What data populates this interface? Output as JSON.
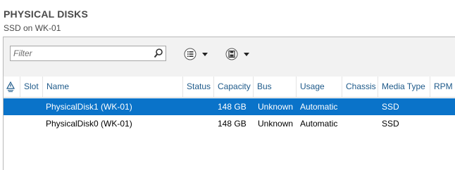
{
  "header": {
    "title": "PHYSICAL DISKS",
    "subtitle": "SSD on WK-01"
  },
  "toolbar": {
    "filter_placeholder": "Filter",
    "search_icon": "search-icon",
    "view_options_icon": "list-view-icon",
    "save_query_icon": "save-icon"
  },
  "table": {
    "columns": [
      "Slot",
      "Name",
      "Status",
      "Capacity",
      "Bus",
      "Usage",
      "Chassis",
      "Media Type",
      "RPM"
    ],
    "rows": [
      {
        "warning": "",
        "slot": "",
        "name": "PhysicalDisk1 (WK-01)",
        "status": "",
        "capacity": "148 GB",
        "bus": "Unknown",
        "usage": "Automatic",
        "chassis": "",
        "media_type": "SSD",
        "rpm": "",
        "selected": true
      },
      {
        "warning": "",
        "slot": "",
        "name": "PhysicalDisk0 (WK-01)",
        "status": "",
        "capacity": "148 GB",
        "bus": "Unknown",
        "usage": "Automatic",
        "chassis": "",
        "media_type": "SSD",
        "rpm": "",
        "selected": false
      }
    ]
  },
  "colors": {
    "selection": "#0a73c9",
    "header_text": "#1e5a8a",
    "toolbar_bg": "#f2f2f2"
  }
}
